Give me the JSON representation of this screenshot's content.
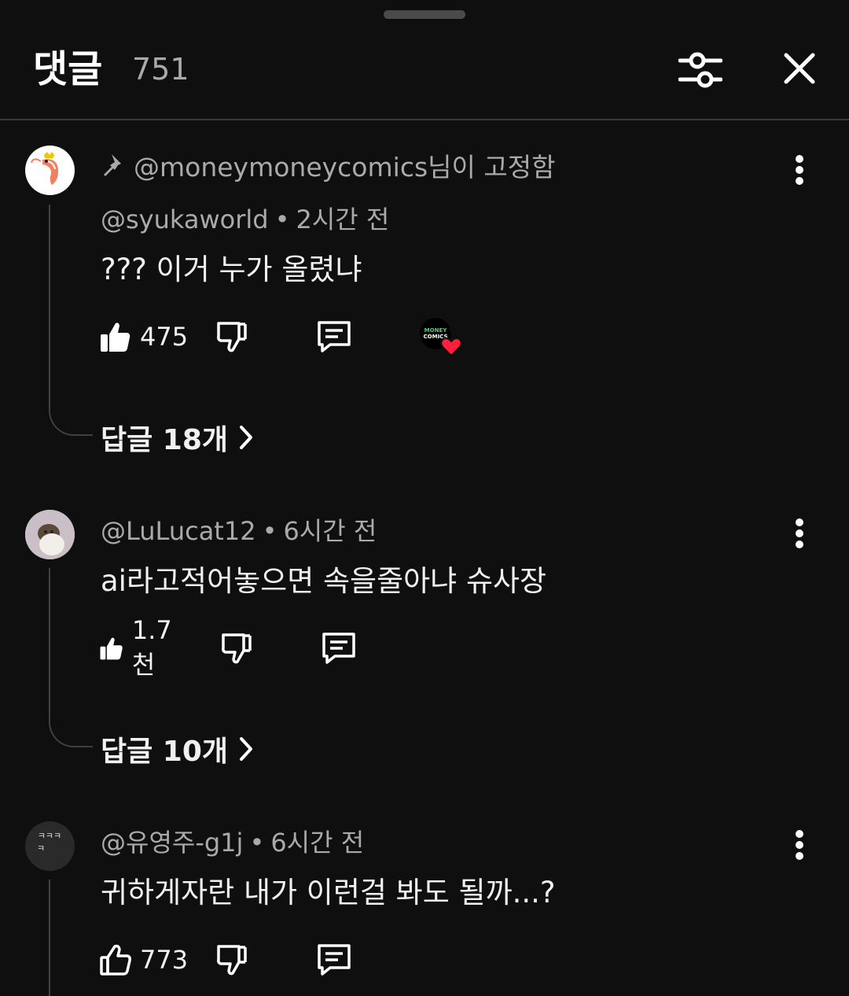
{
  "header": {
    "title": "댓글",
    "count": "751"
  },
  "comments": [
    {
      "pinned_by": "@moneymoneycomics님이 고정함",
      "author": "@syukaworld",
      "time": "2시간 전",
      "text": "??? 이거 누가 올렸냐",
      "likes": "475",
      "hearted": true,
      "heart_badge_text": "MONEY COMICS",
      "replies": "답글 18개"
    },
    {
      "author": "@LuLucat12",
      "time": "6시간 전",
      "text": "ai라고적어놓으면 속을줄아냐 슈사장",
      "likes": "1.7천",
      "replies": "답글 10개"
    },
    {
      "author": "@유영주-g1j",
      "time": "6시간 전",
      "text": "귀하게자란 내가 이런걸 봐도 될까...?",
      "likes": "773",
      "avatar_text": "ㅋㅋㅋ ㅋ"
    }
  ],
  "colors": {
    "background": "#0f0f0f",
    "secondary_text": "#aaaaaa",
    "heart": "#ff1e3c",
    "money_green": "#3ddc6a"
  },
  "icons": [
    "filter-sliders-icon",
    "close-icon",
    "pin-icon",
    "more-vert-icon",
    "thumb-up-icon",
    "thumb-down-icon",
    "reply-icon",
    "chevron-right-icon",
    "heart-icon"
  ]
}
